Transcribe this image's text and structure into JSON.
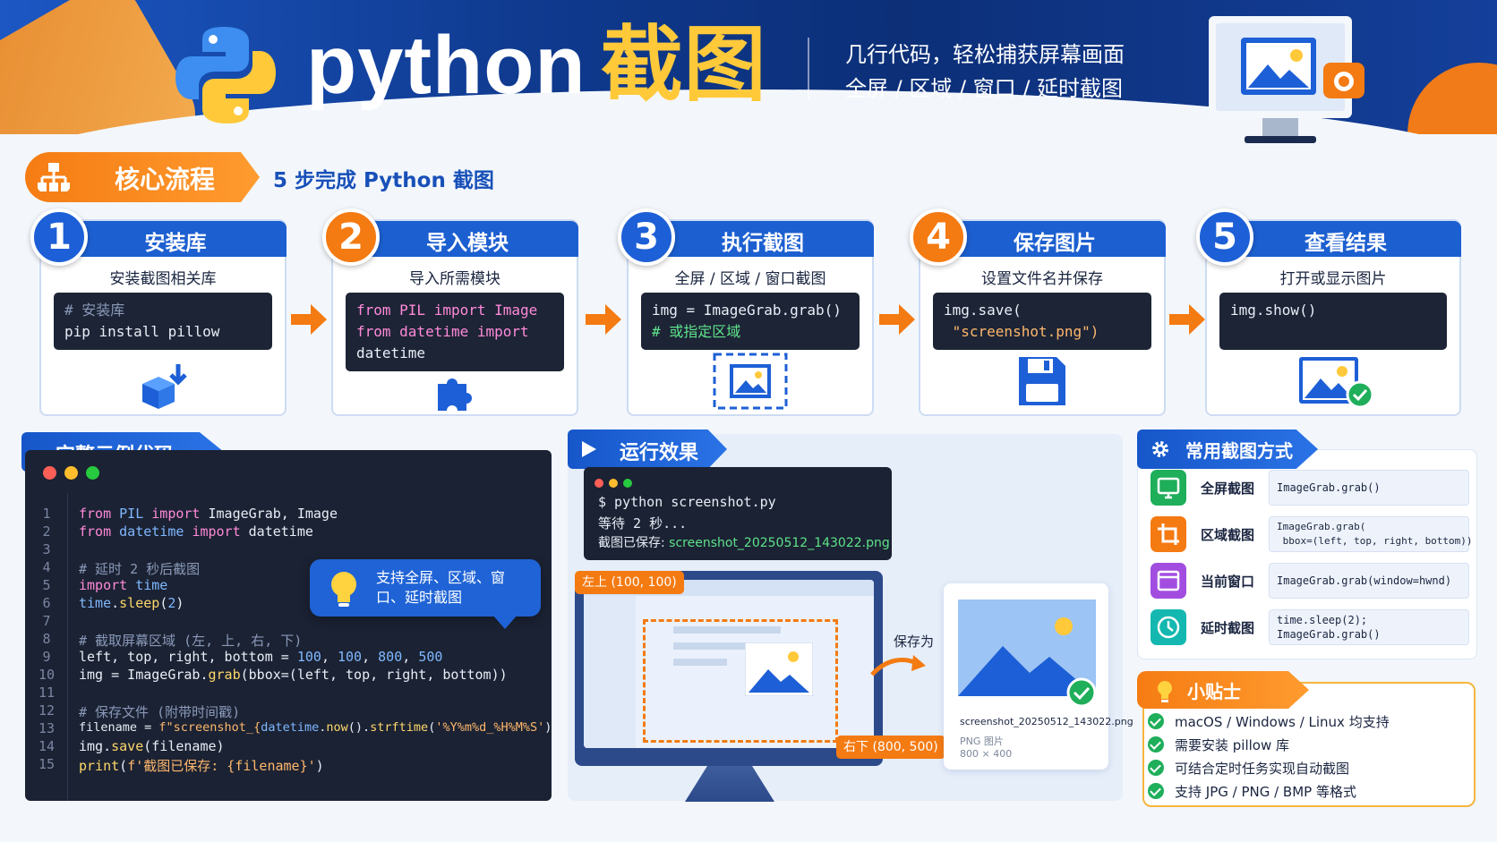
{
  "header": {
    "title_en": "python",
    "title_cn": "截图",
    "subtitle_line1": "几行代码，轻松捕获屏幕画面",
    "subtitle_line2": "全屏 / 区域 / 窗口 / 延时截图"
  },
  "core_flow": {
    "tag": "核心流程",
    "subtitle": "5 步完成 Python 截图"
  },
  "steps": [
    {
      "num": "1",
      "title": "安装库",
      "desc": "安装截图相关库",
      "code_line1": "# 安装库",
      "code_line2": "pip install pillow",
      "icon": "box-download-icon"
    },
    {
      "num": "2",
      "title": "导入模块",
      "desc": "导入所需模块",
      "code_line1": "from PIL import Image",
      "code_line2": "from datetime import",
      "code_line3": "datetime",
      "icon": "puzzle-icon"
    },
    {
      "num": "3",
      "title": "执行截图",
      "desc": "全屏 / 区域 / 窗口截图",
      "code_line1": "img = ImageGrab.grab()",
      "code_line2": "# 或指定区域",
      "icon": "capture-image-icon"
    },
    {
      "num": "4",
      "title": "保存图片",
      "desc": "设置文件名并保存",
      "code_line1": "img.save(",
      "code_line2": " \"screenshot.png\")",
      "icon": "floppy-disk-icon"
    },
    {
      "num": "5",
      "title": "查看结果",
      "desc": "打开或显示图片",
      "code_line1": "img.show()",
      "icon": "image-check-icon"
    }
  ],
  "example": {
    "tag": "完整示例代码",
    "line_numbers": [
      "1",
      "2",
      "3",
      "4",
      "5",
      "6",
      "7",
      "8",
      "9",
      "10",
      "11",
      "12",
      "13",
      "14",
      "15"
    ],
    "tip": "支持全屏、区域、窗口、延时截图"
  },
  "run": {
    "tag": "运行效果",
    "term_line1": "$ python screenshot.py",
    "term_line2": "等待 2 秒...",
    "term_line3_label": "截图已保存: ",
    "term_line3_file": "screenshot_20250512_143022.png",
    "top_left": "左上 (100, 100)",
    "bottom_right": "右下 (800, 500)",
    "save_as": "保存为",
    "file_name": "screenshot_20250512_143022.png",
    "file_type": "PNG 图片",
    "file_size": "800 × 400"
  },
  "methods": {
    "tag": "常用截图方式",
    "items": [
      {
        "label": "全屏截图",
        "code": "ImageGrab.grab()",
        "color": "#1fae5a",
        "icon": "monitor-icon"
      },
      {
        "label": "区域截图",
        "code": "ImageGrab.grab(\n bbox=(left, top, right, bottom))",
        "color": "#f47a12",
        "icon": "crop-icon"
      },
      {
        "label": "当前窗口",
        "code": "ImageGrab.grab(window=hwnd)",
        "color": "#a24de0",
        "icon": "window-icon"
      },
      {
        "label": "延时截图",
        "code": "time.sleep(2); ImageGrab.grab()",
        "color": "#14b8b0",
        "icon": "clock-icon"
      }
    ]
  },
  "tips": {
    "tag": "小贴士",
    "items": [
      "macOS / Windows / Linux 均支持",
      "需要安装 pillow 库",
      "可结合定时任务实现自动截图",
      "支持 JPG / PNG / BMP 等格式"
    ]
  }
}
